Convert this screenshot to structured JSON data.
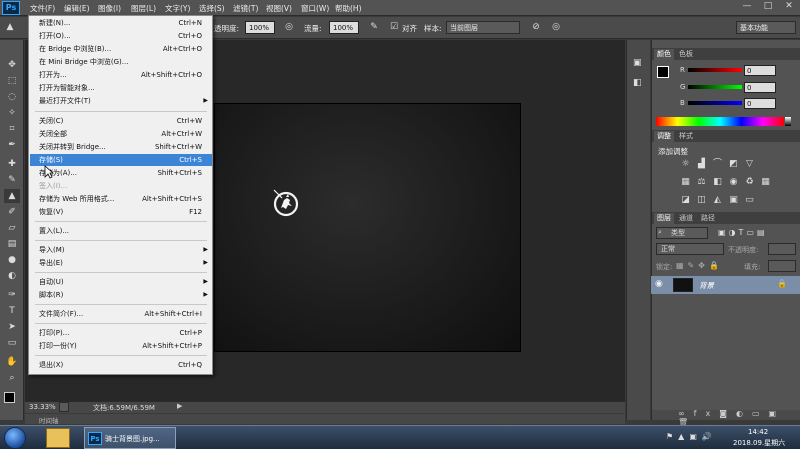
{
  "app": {
    "logo": "Ps"
  },
  "menubar": {
    "items": [
      "文件(F)",
      "编辑(E)",
      "图像(I)",
      "图层(L)",
      "文字(Y)",
      "选择(S)",
      "滤镜(T)",
      "视图(V)",
      "窗口(W)",
      "帮助(H)"
    ],
    "window_buttons": [
      "—",
      "□",
      "✕"
    ]
  },
  "options": {
    "opacity_label": "透明度:",
    "opacity_value": "100%",
    "flow_label": "流量:",
    "flow_value": "100%",
    "align_label": "对齐",
    "sample_label": "样本:",
    "sample_value": "当前图层",
    "workspace": "基本功能"
  },
  "file_menu": {
    "items": [
      {
        "label": "新建(N)...",
        "shortcut": "Ctrl+N",
        "state": "normal"
      },
      {
        "label": "打开(O)...",
        "shortcut": "Ctrl+O",
        "state": "normal"
      },
      {
        "label": "在 Bridge 中浏览(B)...",
        "shortcut": "Alt+Ctrl+O",
        "state": "normal"
      },
      {
        "label": "在 Mini Bridge 中浏览(G)...",
        "shortcut": "",
        "state": "normal"
      },
      {
        "label": "打开为...",
        "shortcut": "Alt+Shift+Ctrl+O",
        "state": "normal"
      },
      {
        "label": "打开为智能对象...",
        "shortcut": "",
        "state": "normal"
      },
      {
        "label": "最近打开文件(T)",
        "shortcut": "",
        "state": "submenu"
      },
      {
        "label": "关闭(C)",
        "shortcut": "Ctrl+W",
        "state": "normal"
      },
      {
        "label": "关闭全部",
        "shortcut": "Alt+Ctrl+W",
        "state": "normal"
      },
      {
        "label": "关闭并转到 Bridge...",
        "shortcut": "Shift+Ctrl+W",
        "state": "normal"
      },
      {
        "label": "存储(S)",
        "shortcut": "Ctrl+S",
        "state": "highlighted"
      },
      {
        "label": "存储为(A)...",
        "shortcut": "Shift+Ctrl+S",
        "state": "normal"
      },
      {
        "label": "签入(I)...",
        "shortcut": "",
        "state": "disabled"
      },
      {
        "label": "存储为 Web 所用格式...",
        "shortcut": "Alt+Shift+Ctrl+S",
        "state": "normal"
      },
      {
        "label": "恢复(V)",
        "shortcut": "F12",
        "state": "normal"
      },
      {
        "label": "置入(L)...",
        "shortcut": "",
        "state": "normal"
      },
      {
        "label": "导入(M)",
        "shortcut": "",
        "state": "submenu"
      },
      {
        "label": "导出(E)",
        "shortcut": "",
        "state": "submenu"
      },
      {
        "label": "自动(U)",
        "shortcut": "",
        "state": "submenu"
      },
      {
        "label": "脚本(R)",
        "shortcut": "",
        "state": "submenu"
      },
      {
        "label": "文件简介(F)...",
        "shortcut": "Alt+Shift+Ctrl+I",
        "state": "normal"
      },
      {
        "label": "打印(P)...",
        "shortcut": "Ctrl+P",
        "state": "normal"
      },
      {
        "label": "打印一份(Y)",
        "shortcut": "Alt+Shift+Ctrl+P",
        "state": "normal"
      },
      {
        "label": "退出(X)",
        "shortcut": "Ctrl+Q",
        "state": "normal"
      }
    ]
  },
  "status": {
    "zoom": "33.33%",
    "doc_info": "文档:6.59M/6.59M"
  },
  "timeline_tab": "时间轴",
  "color_panel": {
    "tabs": [
      "颜色",
      "色板"
    ],
    "channels": [
      {
        "label": "R",
        "value": "0",
        "color": "#d93a3a"
      },
      {
        "label": "G",
        "value": "0",
        "color": "#2fa83a"
      },
      {
        "label": "B",
        "value": "0",
        "color": "#3a5ad9"
      }
    ]
  },
  "adjustments_panel": {
    "tabs": [
      "调整",
      "样式"
    ],
    "title": "添加调整"
  },
  "layers_panel": {
    "tabs": [
      "图层",
      "通道",
      "路径"
    ],
    "kind_filter": "类型",
    "blend_mode": "正常",
    "opacity_label": "不透明度:",
    "lock_label": "锁定:",
    "fill_label": "填充:",
    "layer_name": "背景"
  },
  "taskbar": {
    "task_label": "骑士背景图.jpg...",
    "time": "14:42",
    "date": "2018.09.星期六"
  },
  "colors": {
    "highlight": "#3c84d6",
    "ps_blue": "#31a8ff"
  }
}
